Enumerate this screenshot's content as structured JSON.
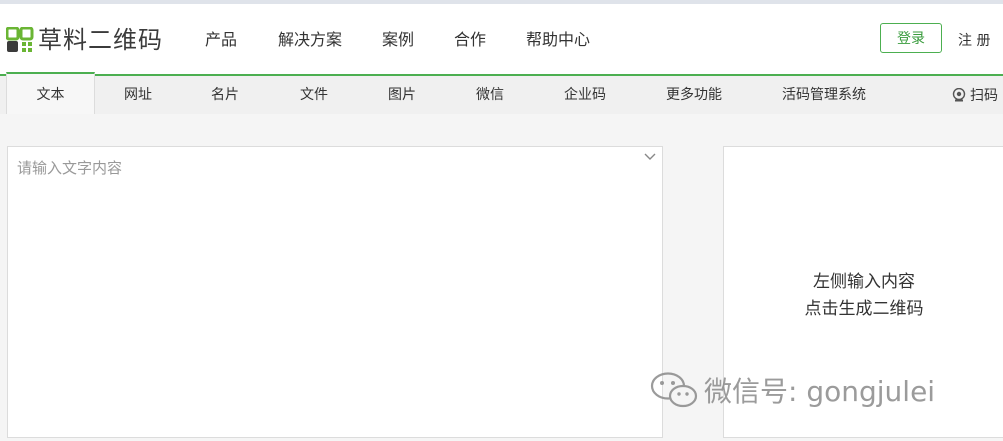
{
  "header": {
    "logo_text": "草料二维码",
    "nav": [
      "产品",
      "解决方案",
      "案例",
      "合作",
      "帮助中心"
    ],
    "login_label": "登录",
    "register_label": "注 册"
  },
  "tabs": {
    "items": [
      "文本",
      "网址",
      "名片",
      "文件",
      "图片",
      "微信",
      "企业码",
      "更多功能",
      "活码管理系统"
    ],
    "active": "文本",
    "scan_label": "扫码"
  },
  "editor": {
    "placeholder": "请输入文字内容",
    "value": ""
  },
  "preview": {
    "hint_line1": "左侧输入内容",
    "hint_line2": "点击生成二维码"
  },
  "watermark": {
    "text": "微信号: gongjulei"
  },
  "colors": {
    "accent": "#4caf50",
    "logo_green": "#6ab534",
    "page_bg": "#f5f5f5"
  }
}
